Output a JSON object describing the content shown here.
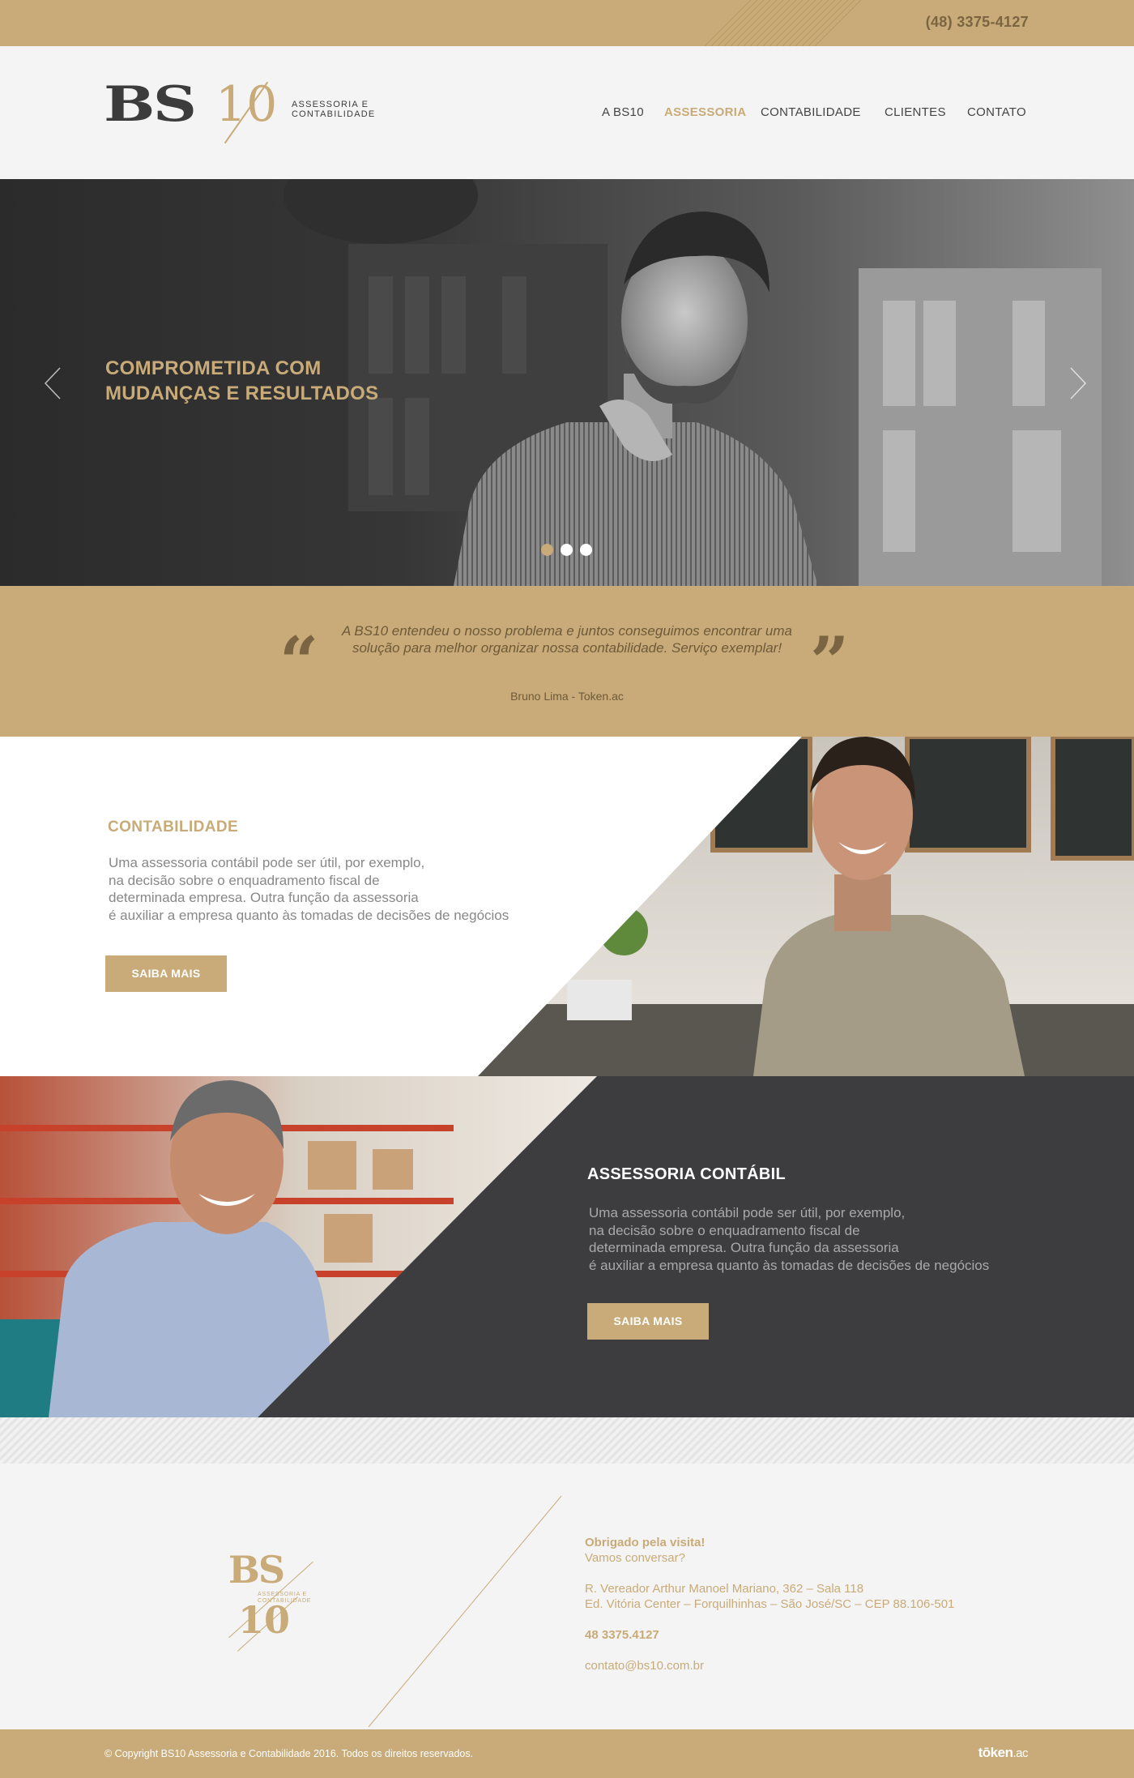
{
  "colors": {
    "accent": "#c8ab78",
    "dark": "#3d3d3f",
    "accent_dark": "#7a6441"
  },
  "topbar": {
    "phone": "(48) 3375-4127"
  },
  "header": {
    "logo": {
      "bs": "BS",
      "ten": "10",
      "tagline_1": "ASSESSORIA E",
      "tagline_2": "CONTABILIDADE"
    },
    "nav": [
      {
        "label": "A BS10",
        "active": false
      },
      {
        "label": "ASSESSORIA",
        "active": true
      },
      {
        "label": "CONTABILIDADE",
        "active": false
      },
      {
        "label": "CLIENTES",
        "active": false
      },
      {
        "label": "CONTATO",
        "active": false
      }
    ]
  },
  "hero": {
    "title_line_1": "COMPROMETIDA COM",
    "title_line_2": "MUDANÇAS E RESULTADOS",
    "prev_icon": "chevron-left-icon",
    "next_icon": "chevron-right-icon",
    "slides": 3,
    "active_slide": 1
  },
  "testimonial": {
    "open_quote": "“",
    "close_quote": "”",
    "quote": "A BS10 entendeu o nosso problema e juntos conseguimos encontrar uma solução para melhor organizar nossa contabilidade. Serviço exemplar!",
    "author": "Bruno Lima - Token.ac"
  },
  "contabilidade": {
    "title": "CONTABILIDADE",
    "text": "Uma assessoria contábil pode ser útil, por exemplo,\nna decisão sobre o enquadramento fiscal de\ndeterminada empresa. Outra função da assessoria\né auxiliar a empresa quanto às tomadas de decisões de negócios",
    "button": "SAIBA MAIS"
  },
  "assessoria": {
    "title": "ASSESSORIA CONTÁBIL",
    "text": "Uma assessoria contábil pode ser útil, por exemplo,\nna decisão sobre o enquadramento fiscal de\ndeterminada empresa. Outra função da assessoria\né auxiliar a empresa quanto às tomadas de decisões de negócios",
    "button": "SAIBA MAIS"
  },
  "footer": {
    "logo": {
      "bs": "BS",
      "ten": "10",
      "tagline_1": "ASSESSORIA E",
      "tagline_2": "CONTABILIDADE"
    },
    "thanks": "Obrigado pela visita!",
    "talk": "Vamos conversar?",
    "address_1": "R. Vereador Arthur Manoel Mariano, 362 –  Sala 118",
    "address_2": "Ed. Vitória Center – Forquilhinhas – São José/SC – CEP 88.106-501",
    "phone": "48 3375.4127",
    "email": "contato@bs10.com.br"
  },
  "bottombar": {
    "copyright": "© Copyright BS10 Assessoria e Contabilidade 2016. Todos os direitos reservados.",
    "credit_bold": "tōken",
    "credit_rest": ".ac"
  }
}
